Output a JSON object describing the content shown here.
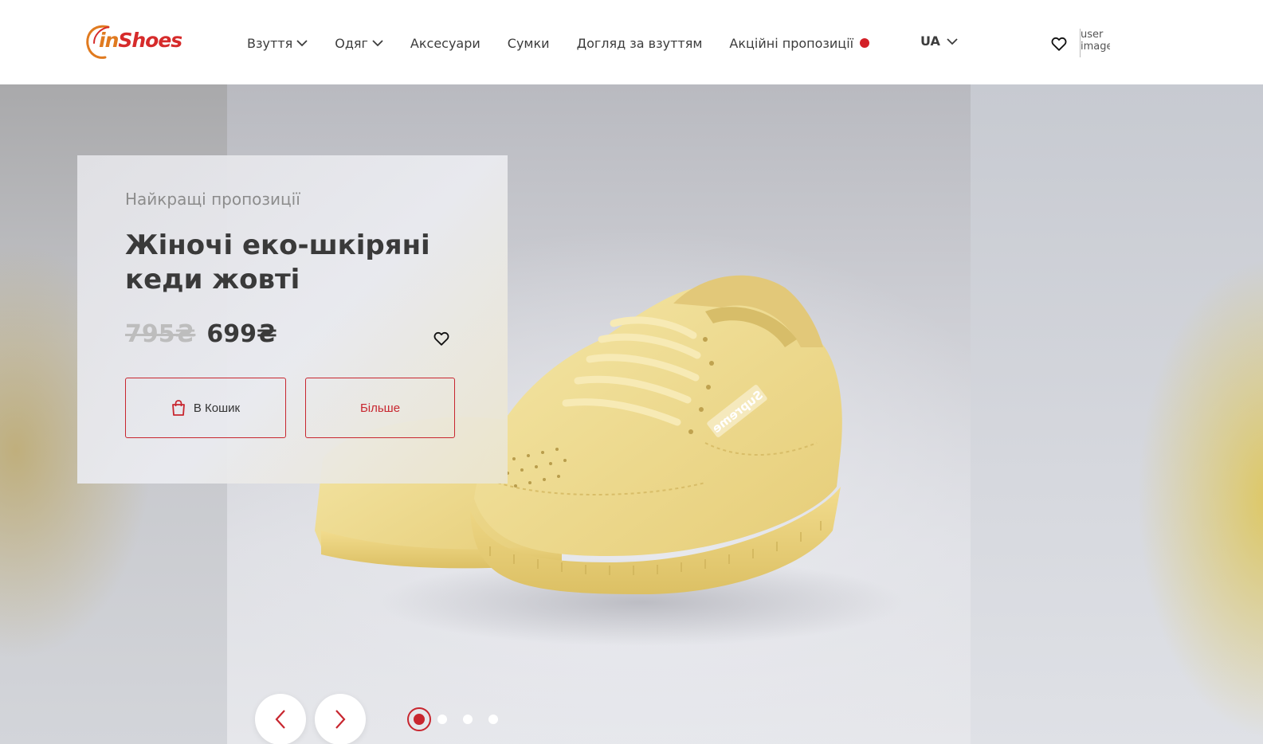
{
  "header": {
    "logo": {
      "prefix": "in",
      "suffix": "Shoes"
    },
    "nav": [
      {
        "label": "Взуття",
        "has_dropdown": true
      },
      {
        "label": "Одяг",
        "has_dropdown": true
      },
      {
        "label": "Аксесуари",
        "has_dropdown": false
      },
      {
        "label": "Сумки",
        "has_dropdown": false
      },
      {
        "label": "Догляд за взуттям",
        "has_dropdown": false
      },
      {
        "label": "Акційні пропозиції",
        "has_dropdown": false,
        "badge_color": "#d32027"
      }
    ],
    "language": "UA",
    "user_image_alt": "user image",
    "icons": {
      "favorites": "heart-icon",
      "language_toggle": "chevron-down-icon"
    }
  },
  "hero": {
    "card": {
      "tagline": "Найкращі пропозиції",
      "title": "Жіночі еко-шкіряні кеди жовті",
      "price_old": "795₴",
      "price_new": "699₴",
      "add_to_cart_label": "В Кошик",
      "more_label": "Більше"
    },
    "image_description": "yellow eco-leather sneakers",
    "shoe_text": "Supreme",
    "slider": {
      "active_slide": 1,
      "total_slides": 4
    }
  },
  "colors": {
    "accent": "#c8262f",
    "text_dark": "#3a3a3a",
    "text_muted": "#8c8c8c",
    "price_old": "#bdbdbd"
  }
}
